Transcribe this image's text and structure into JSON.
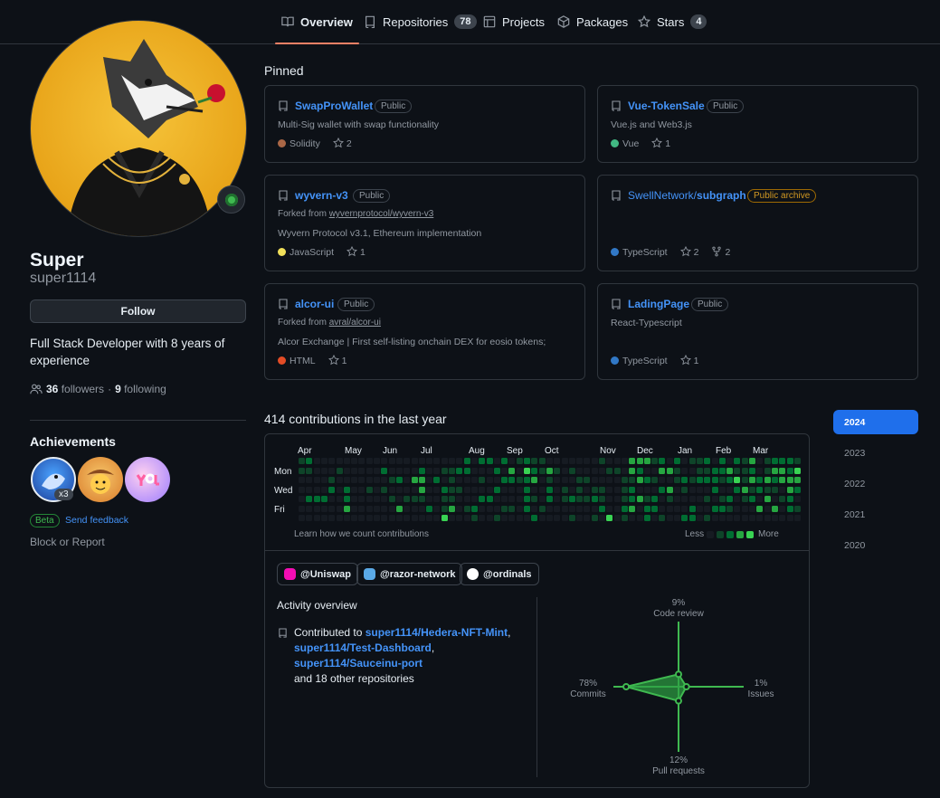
{
  "nav": {
    "tabs": [
      {
        "label": "Overview",
        "icon": "book-icon"
      },
      {
        "label": "Repositories",
        "count": "78",
        "icon": "repo-icon"
      },
      {
        "label": "Projects",
        "icon": "table-icon"
      },
      {
        "label": "Packages",
        "icon": "package-icon"
      },
      {
        "label": "Stars",
        "count": "4",
        "icon": "star-icon"
      }
    ]
  },
  "profile": {
    "name": "Super",
    "login": "super1114",
    "follow_label": "Follow",
    "bio": "Full Stack Developer with 8 years of experience",
    "followers_count": "36",
    "followers_label": "followers",
    "separator": "·",
    "following_count": "9",
    "following_label": "following",
    "achievements_title": "Achievements",
    "achievement_multiplier": "x3",
    "beta_label": "Beta",
    "feedback_label": "Send feedback",
    "block_label": "Block or Report"
  },
  "pinned": {
    "title": "Pinned",
    "cards": [
      {
        "name": "SwapProWallet",
        "visibility": "Public",
        "description": "Multi-Sig wallet with swap functionality",
        "language": "Solidity",
        "lang_color": "#AA6746",
        "stars": "2"
      },
      {
        "name": "Vue-TokenSale",
        "visibility": "Public",
        "description": "Vue.js and Web3.js",
        "language": "Vue",
        "lang_color": "#41b883",
        "stars": "1"
      },
      {
        "name": "wyvern-v3",
        "visibility": "Public",
        "forked_prefix": "Forked from",
        "forked_from": "wyvernprotocol/wyvern-v3",
        "description": "Wyvern Protocol v3.1, Ethereum implementation",
        "language": "JavaScript",
        "lang_color": "#f1e05a",
        "stars": "1"
      },
      {
        "name_owner": "SwellNetwork/",
        "name": "subgraph",
        "visibility": "Public archive",
        "language": "TypeScript",
        "lang_color": "#3178c6",
        "stars": "2",
        "forks": "2"
      },
      {
        "name": "alcor-ui",
        "visibility": "Public",
        "forked_prefix": "Forked from",
        "forked_from": "avral/alcor-ui",
        "description": "Alcor Exchange | First self-listing onchain DEX for eosio tokens;",
        "language": "HTML",
        "lang_color": "#e34c26",
        "stars": "1"
      },
      {
        "name": "LadingPage",
        "visibility": "Public",
        "description": "React-Typescript",
        "language": "TypeScript",
        "lang_color": "#3178c6",
        "stars": "1"
      }
    ]
  },
  "contributions": {
    "title": "414 contributions in the last year",
    "months": [
      "Apr",
      "May",
      "Jun",
      "Jul",
      "Aug",
      "Sep",
      "Oct",
      "Nov",
      "Dec",
      "Jan",
      "Feb",
      "Mar"
    ],
    "days": [
      "Mon",
      "Wed",
      "Fri"
    ],
    "learn_label": "Learn how we count contributions",
    "less_label": "Less",
    "more_label": "More",
    "levels_colors": [
      "#161b22",
      "#0e4429",
      "#006d32",
      "#26a641",
      "#39d353"
    ],
    "grid": [
      "1200000000000000000000202202012110000000100033312020112020213012221",
      "1100010000020000200112200020304213101000011032003310011223112013324",
      "0000100000001203302010001002212301000110000113210012122212413232333",
      "0000202001010000300211000020002002010101100120002301000200231211032",
      "0222002000001011100110002200002102012112100123120100001012012030120",
      "0000003000000300020130120001102010000000200230220000200221000303021",
      "0000000000000000000400010010000200001001040100201002201000000000000"
    ]
  },
  "orgs": [
    {
      "label": "@Uniswap",
      "color": "#f50db4"
    },
    {
      "label": "@razor-network",
      "color": "#5aa9e6"
    },
    {
      "label": "@ordinals",
      "color": "#ffffff"
    }
  ],
  "activity": {
    "title": "Activity overview",
    "contributed_prefix": "Contributed to",
    "repos": [
      "super1114/Hedera-NFT-Mint",
      "super1114/Test-Dashboard",
      "super1114/Sauceinu-port"
    ],
    "other_repos": "and 18 other repositories",
    "radar": {
      "code_review_pct": "9%",
      "code_review_label": "Code review",
      "commits_pct": "78%",
      "commits_label": "Commits",
      "issues_pct": "1%",
      "issues_label": "Issues",
      "pull_requests_pct": "12%",
      "pull_requests_label": "Pull requests",
      "values": {
        "code_review": 9,
        "commits": 78,
        "issues": 1,
        "pull_requests": 12
      }
    }
  },
  "years": [
    "2024",
    "2023",
    "2022",
    "2021",
    "2020"
  ]
}
